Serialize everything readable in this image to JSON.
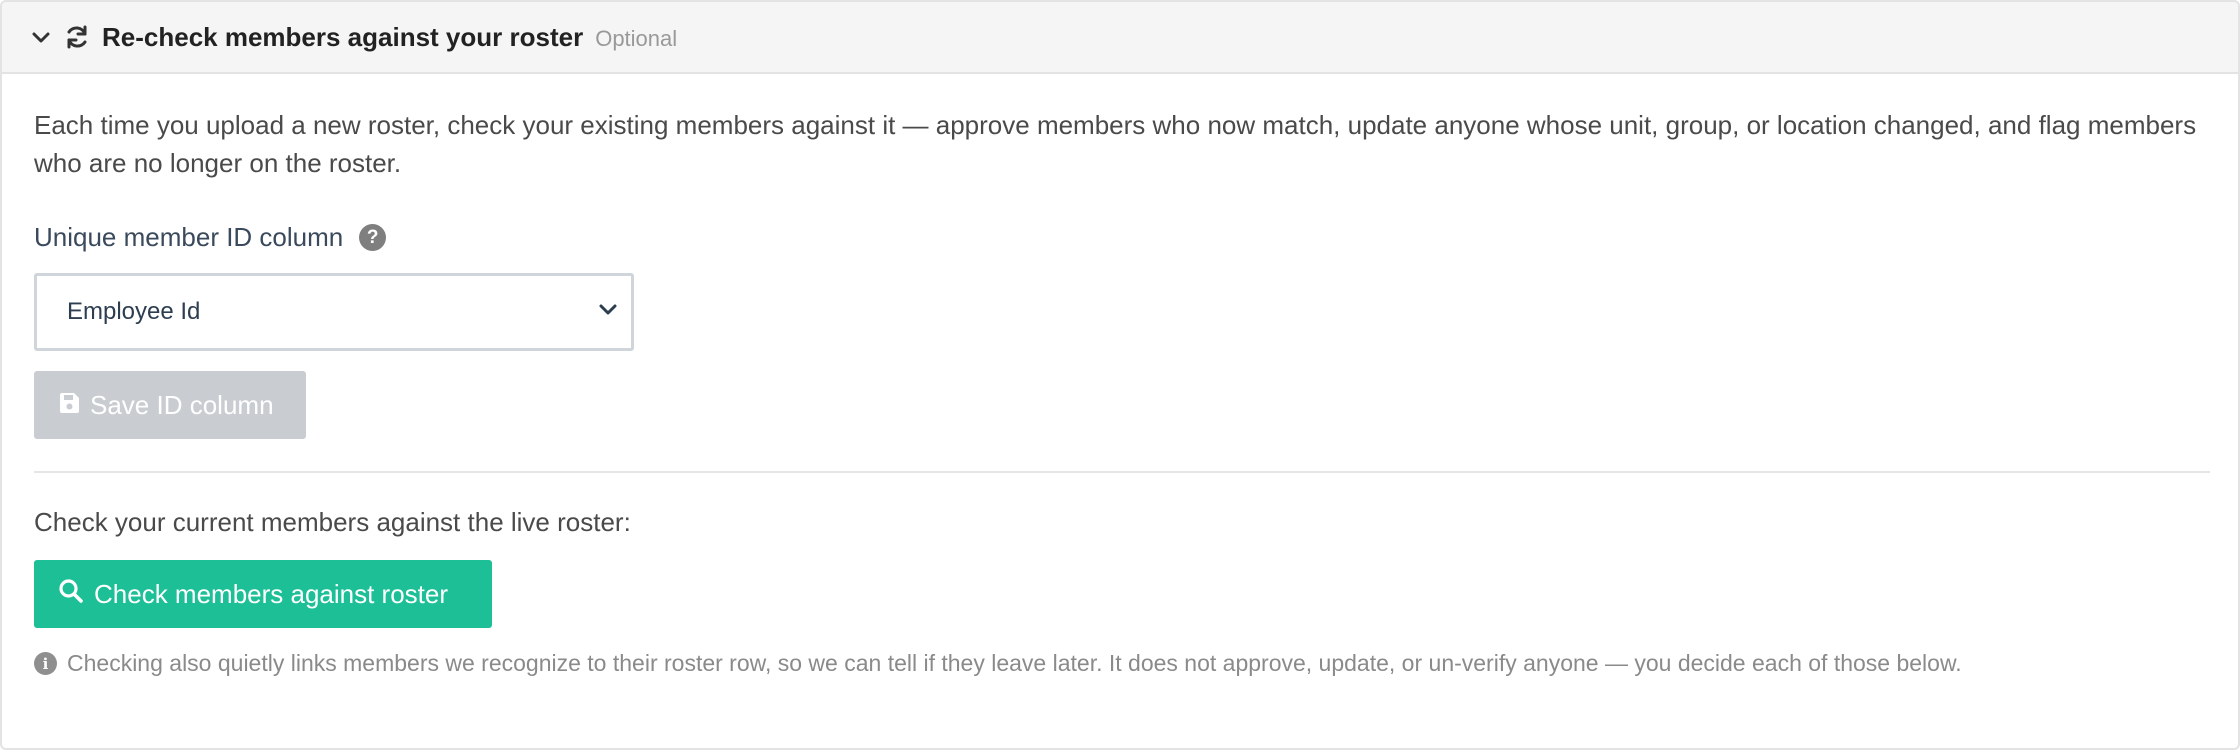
{
  "header": {
    "title": "Re-check members against your roster",
    "badge": "Optional",
    "collapse_icon": "chevron-down-icon",
    "title_icon": "refresh-icon"
  },
  "description": "Each time you upload a new roster, check your existing members against it — approve members who now match, update anyone whose unit, group, or location changed, and flag members who are no longer on the roster.",
  "id_column": {
    "label": "Unique member ID column",
    "help_glyph": "?",
    "selected": "Employee Id",
    "save_label": "Save ID column",
    "save_disabled": true
  },
  "check": {
    "label": "Check your current members against the live roster:",
    "button_label": "Check members against roster",
    "button_color": "#1dbf97",
    "note_glyph": "i",
    "note": "Checking also quietly links members we recognize to their roster row, so we can tell if they leave later. It does not approve, update, or un-verify anyone — you decide each of those below."
  }
}
